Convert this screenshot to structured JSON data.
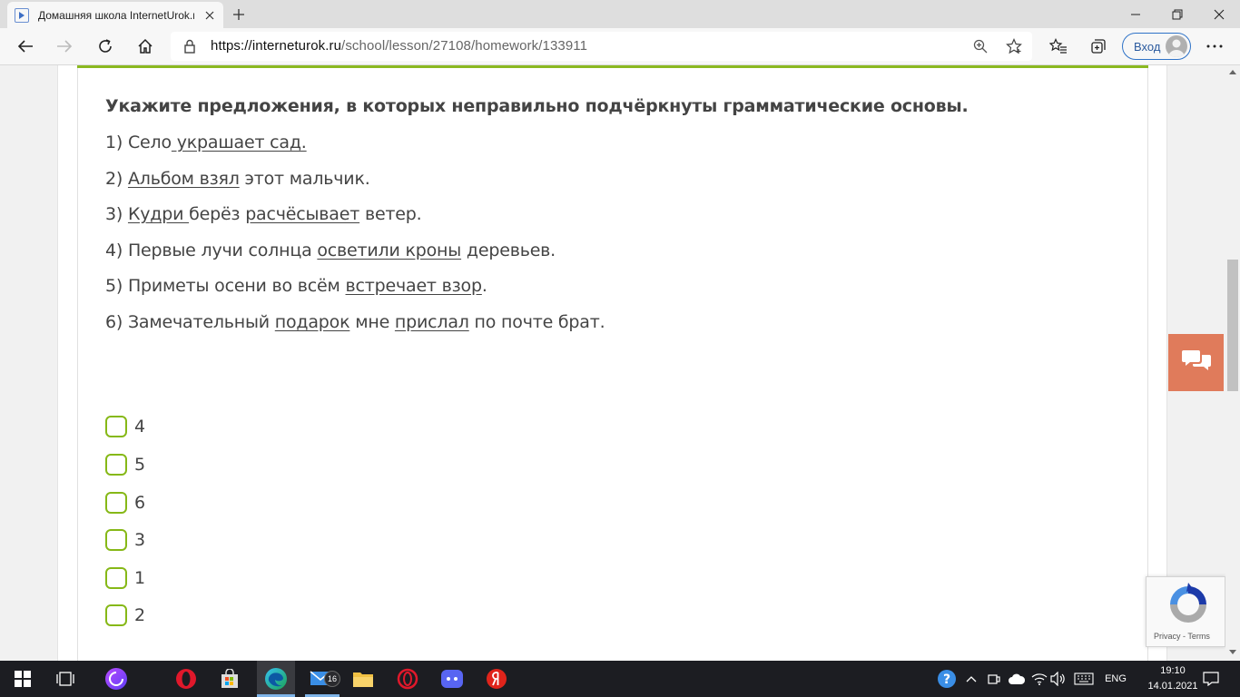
{
  "browser": {
    "tab_title": "Домашняя школа InternetUrok.r",
    "url_host": "https://interneturok.ru",
    "url_path": "/school/lesson/27108/homework/133911",
    "signin_label": "Вход"
  },
  "task": {
    "question": "Укажите предложения, в которых неправильно подчёркнуты грамматические основы.",
    "sentences": [
      {
        "parts": [
          "1) Село",
          " украшает сад.",
          ""
        ]
      },
      {
        "parts": [
          "2) ",
          "Альбом взял",
          " этот мальчик."
        ]
      },
      {
        "parts": [
          "3) ",
          "Кудри ",
          "берёз ",
          "расчёсывает",
          " ветер."
        ]
      },
      {
        "parts": [
          "4) Первые лучи солнца ",
          "осветили кроны",
          " деревьев."
        ]
      },
      {
        "parts": [
          "5) Приметы осени во всём ",
          "встречает взор",
          "."
        ]
      },
      {
        "parts": [
          "6) Замечательный ",
          "подарок",
          " мне ",
          "прислал",
          " по почте брат."
        ]
      }
    ],
    "options": [
      "4",
      "5",
      "6",
      "3",
      "1",
      "2"
    ]
  },
  "recaptcha": {
    "text": "Privacy - Terms"
  },
  "taskbar": {
    "mail_badge": "16",
    "lang": "ENG",
    "time": "19:10",
    "date": "14.01.2021"
  },
  "colors": {
    "accent_green": "#86b817",
    "chat_button": "#e07b5b",
    "taskbar": "#1c1d22"
  }
}
